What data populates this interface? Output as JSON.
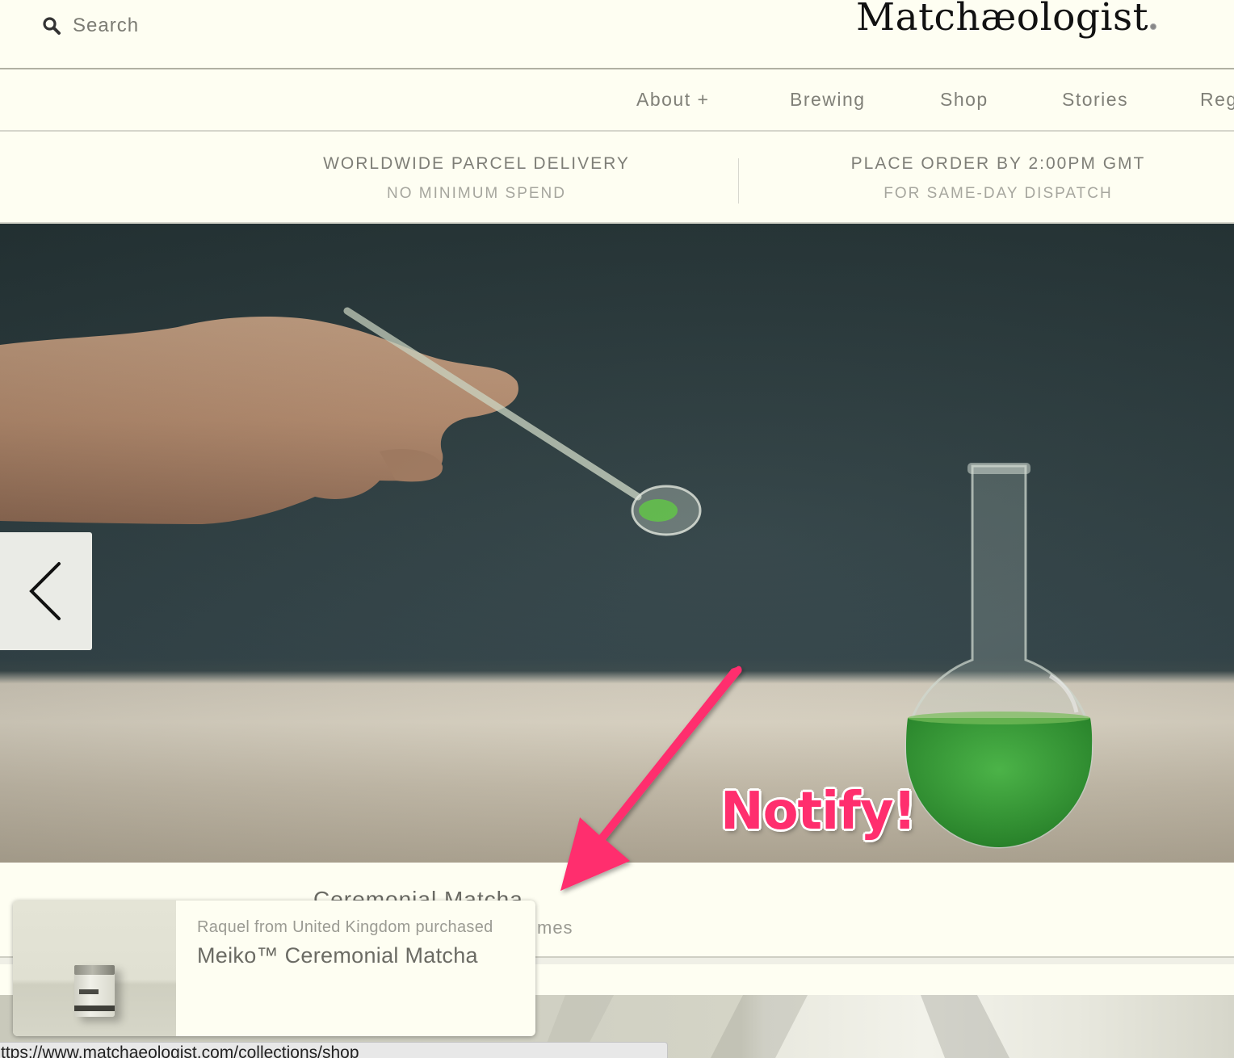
{
  "header": {
    "search_label": "Search",
    "logo_text": "Matchæologist",
    "icons": {
      "search": "search-icon",
      "registered": "registered-mark-icon"
    }
  },
  "nav": {
    "items": [
      {
        "label": "About +"
      },
      {
        "label": "Brewing"
      },
      {
        "label": "Shop"
      },
      {
        "label": "Stories"
      },
      {
        "label": "Reg"
      }
    ]
  },
  "shipping_info": [
    {
      "title": "WORLDWIDE PARCEL DELIVERY",
      "subtitle": "NO MINIMUM SPEND"
    },
    {
      "title": "PLACE ORDER BY 2:00PM GMT",
      "subtitle": "FOR SAME-DAY DISPATCH"
    }
  ],
  "hero": {
    "prev_icon": "chevron-left-icon",
    "colors": {
      "wall": "#2e3f42",
      "table": "#ddd5c4",
      "matcha": "#3aa33a"
    }
  },
  "annotation": {
    "label": "Notify!",
    "color": "#ff2e6e"
  },
  "product": {
    "title": "Ceremonial Matcha",
    "subtitle_fragment": "times"
  },
  "popup": {
    "line1": "Raquel from United Kingdom purchased",
    "line2": "Meiko™ Ceremonial Matcha"
  },
  "status_bar": {
    "url": "ttps://www.matchaeologist.com/collections/shop"
  }
}
